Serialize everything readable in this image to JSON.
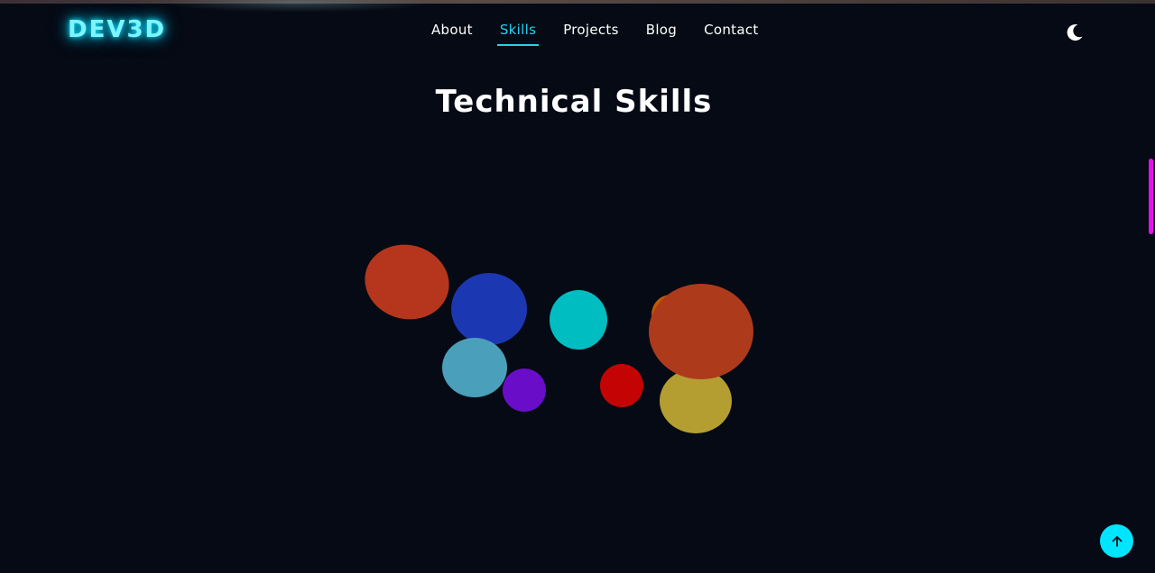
{
  "brand": {
    "logo": "DEV3D",
    "glow_color": "#00e5ff"
  },
  "nav": {
    "items": [
      {
        "label": "About",
        "active": false
      },
      {
        "label": "Skills",
        "active": true
      },
      {
        "label": "Projects",
        "active": false
      },
      {
        "label": "Blog",
        "active": false
      },
      {
        "label": "Contact",
        "active": false
      }
    ]
  },
  "theme_toggle": {
    "icon": "moon-icon"
  },
  "skills": {
    "title": "Technical Skills",
    "bubble_colors": [
      "#b5361c",
      "#1c37b2",
      "#00bdc2",
      "#4aa0ba",
      "#6a0dc9",
      "#c40404",
      "#c15a00",
      "#ae3a1c",
      "#b49e32"
    ]
  },
  "colors": {
    "background": "#050a14",
    "accent": "#22d3ee",
    "scroll_indicator": "#e311e8",
    "scroll_top_button": "#00e5ff"
  },
  "scroll_top": {
    "icon": "arrow-up-icon"
  }
}
